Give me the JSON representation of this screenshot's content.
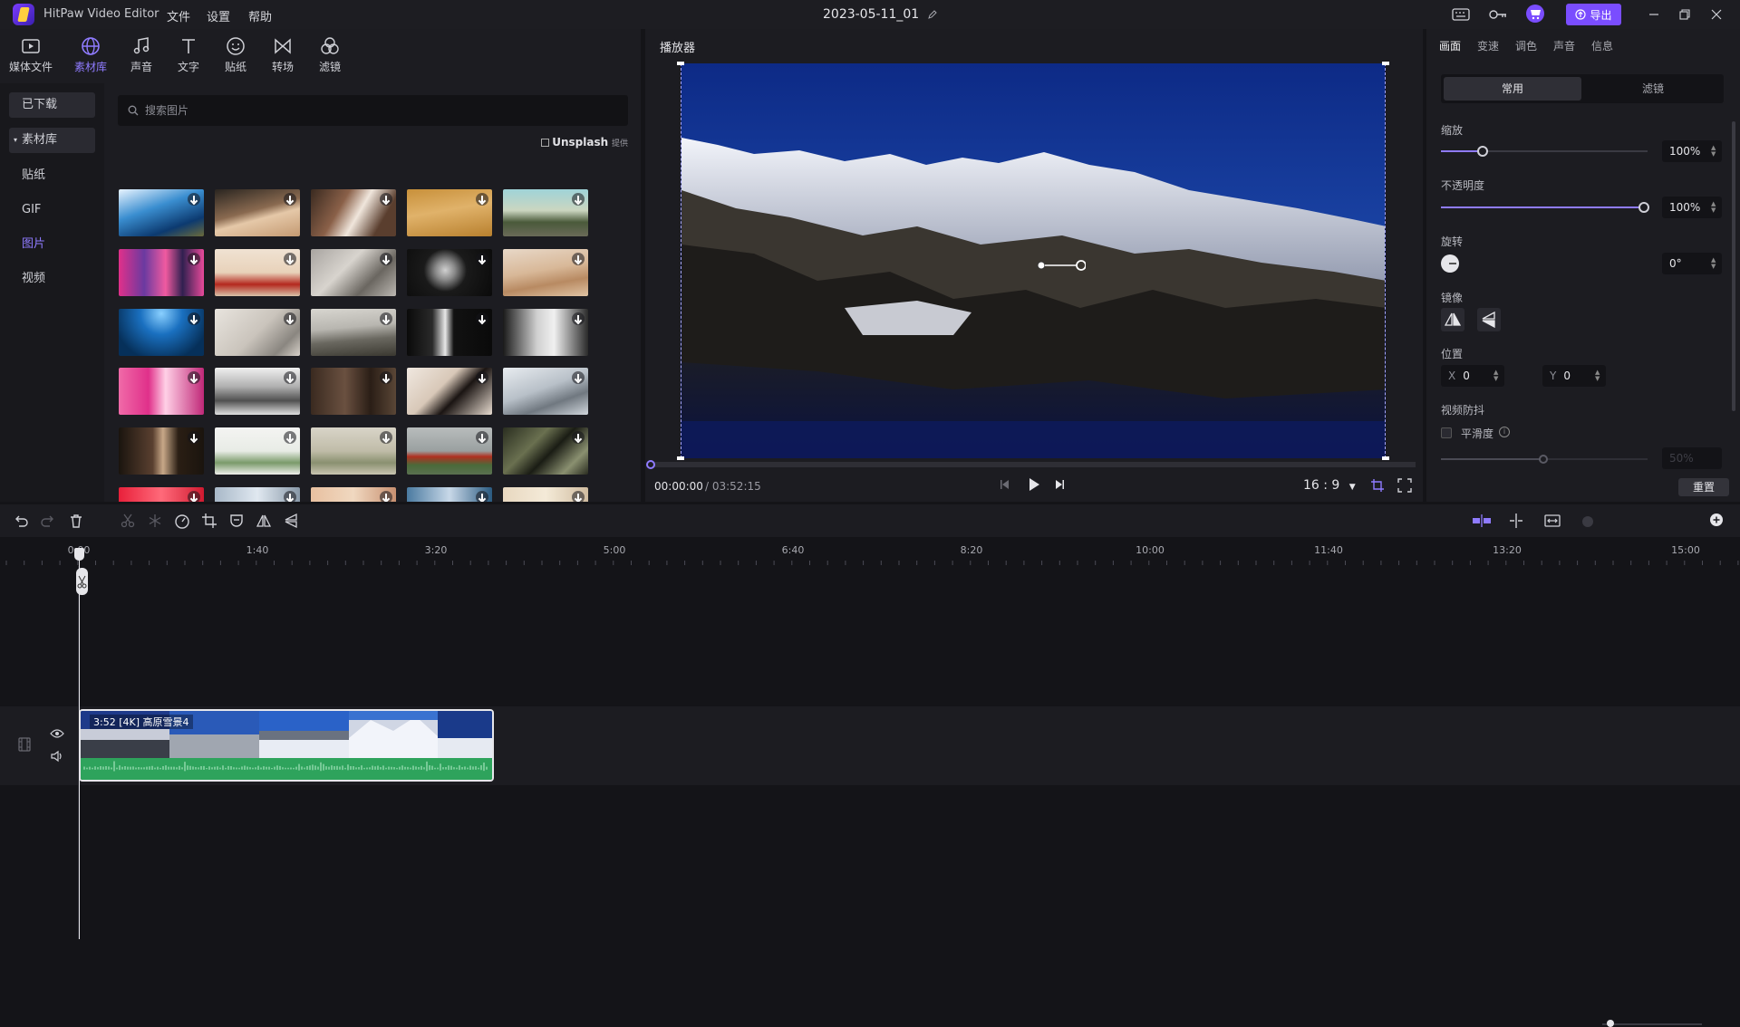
{
  "app": {
    "name": "HitPaw Video Editor",
    "project_title": "2023-05-11_01",
    "menu": [
      "文件",
      "设置",
      "帮助"
    ],
    "export_label": "导出"
  },
  "media_tabs": [
    "媒体文件",
    "素材库",
    "声音",
    "文字",
    "贴纸",
    "转场",
    "滤镜"
  ],
  "left_nav": {
    "downloaded": "已下载",
    "library": "素材库",
    "items": [
      "贴纸",
      "GIF",
      "图片",
      "视频"
    ]
  },
  "search": {
    "placeholder": "搜索图片"
  },
  "unsplash": {
    "name": "Unsplash",
    "suffix": "提供"
  },
  "player": {
    "title": "播放器",
    "time_current": "00:00:00",
    "time_total": "/ 03:52:15",
    "aspect": "16 : 9"
  },
  "right_panel": {
    "tabs": [
      "画面",
      "变速",
      "调色",
      "声音",
      "信息"
    ],
    "segments": [
      "常用",
      "滤镜"
    ],
    "scale_label": "缩放",
    "scale_value": "100%",
    "opacity_label": "不透明度",
    "opacity_value": "100%",
    "rotate_label": "旋转",
    "rotate_value": "0°",
    "mirror_label": "镜像",
    "position_label": "位置",
    "pos_x_label": "X",
    "pos_x": "0",
    "pos_y_label": "Y",
    "pos_y": "0",
    "stabilize_label": "视频防抖",
    "smooth_label": "平滑度",
    "smooth_value": "50%",
    "reset_label": "重置"
  },
  "timeline": {
    "ticks": [
      "0:00",
      "1:40",
      "3:20",
      "5:00",
      "6:40",
      "8:20",
      "10:00",
      "11:40",
      "13:20",
      "15:00"
    ],
    "clip_label": "3:52    [4K]  高原雪景4"
  },
  "colors": {
    "accent": "#8f7bff",
    "export": "#7a4dff",
    "audio_wave": "#2ea35c"
  }
}
